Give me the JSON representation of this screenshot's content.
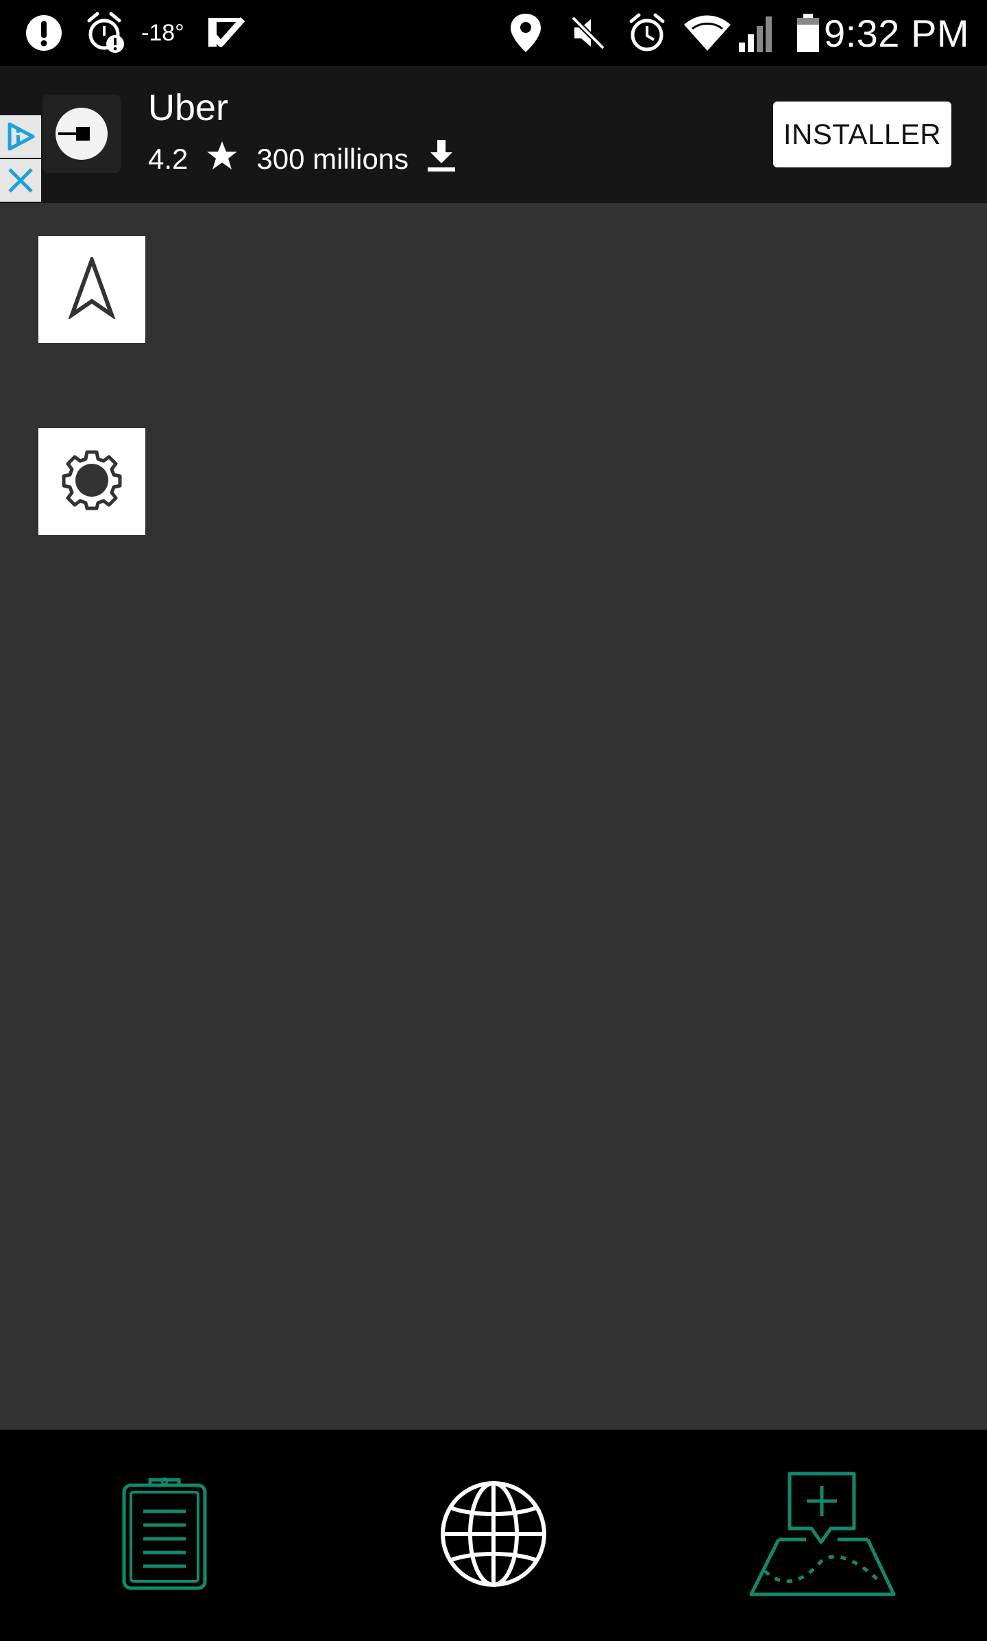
{
  "status_bar": {
    "temperature": "-18°",
    "time": "9:32 PM"
  },
  "ad": {
    "app_name": "Uber",
    "rating": "4.2",
    "downloads": "300 millions",
    "install_label": "INSTALLER"
  },
  "map_controls": {
    "compass_icon": "navigation-arrow-icon",
    "settings_icon": "gear-icon"
  },
  "bottom_nav": {
    "items": [
      {
        "icon": "clipboard-icon"
      },
      {
        "icon": "globe-icon"
      },
      {
        "icon": "add-place-map-icon"
      }
    ]
  },
  "colors": {
    "map_background": "#323232",
    "accent_green": "#0f8a6c",
    "ad_choices_blue": "#1aa3d9"
  }
}
